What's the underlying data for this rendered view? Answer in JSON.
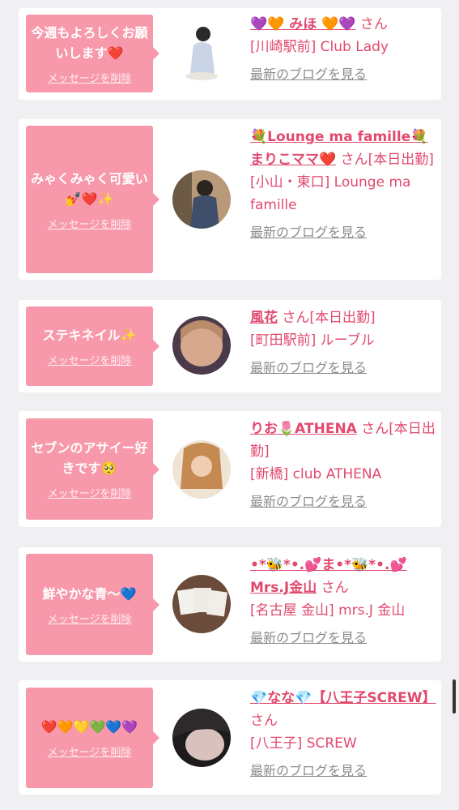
{
  "delete_label": "メッセージを削除",
  "blog_label": "最新のブログを見る",
  "san_label": "さん",
  "colors": {
    "accent": "#e2496e",
    "bubble": "#f799ab",
    "background": "#f0f0f2"
  },
  "cards": [
    {
      "message": "今週もよろしくお願いします❤️",
      "name": "💜🧡 みほ 🧡💜",
      "after_name": "さん",
      "shop": "[川崎駅前] Club Lady"
    },
    {
      "message": "みゃくみゃく可愛い💅❤️✨",
      "name": "💐Lounge ma famille💐まりこママ❤️",
      "after_name": "さん[本日出勤]",
      "shop": "[小山・東口] Lounge ma famille"
    },
    {
      "message": "ステキネイル✨",
      "name": "風花",
      "after_name": "さん[本日出勤]",
      "shop": "[町田駅前] ルーブル"
    },
    {
      "message": "セブンのアサイー好きです🥺",
      "name": "りお🌷ATHENA",
      "after_name": "さん[本日出勤]",
      "shop": "[新橋] club ATHENA"
    },
    {
      "message": "鮮やかな青〜💙",
      "name": "•*🐝*•.💕ま•*🐝*•.💕Mrs.J金山",
      "after_name": "さん",
      "shop": "[名古屋 金山] mrs.J 金山"
    },
    {
      "message": "❤️🧡💛💚💙💜",
      "name": "💎なな💎【八王子SCREW】",
      "after_name": "さん",
      "shop": "[八王子] SCREW"
    }
  ]
}
